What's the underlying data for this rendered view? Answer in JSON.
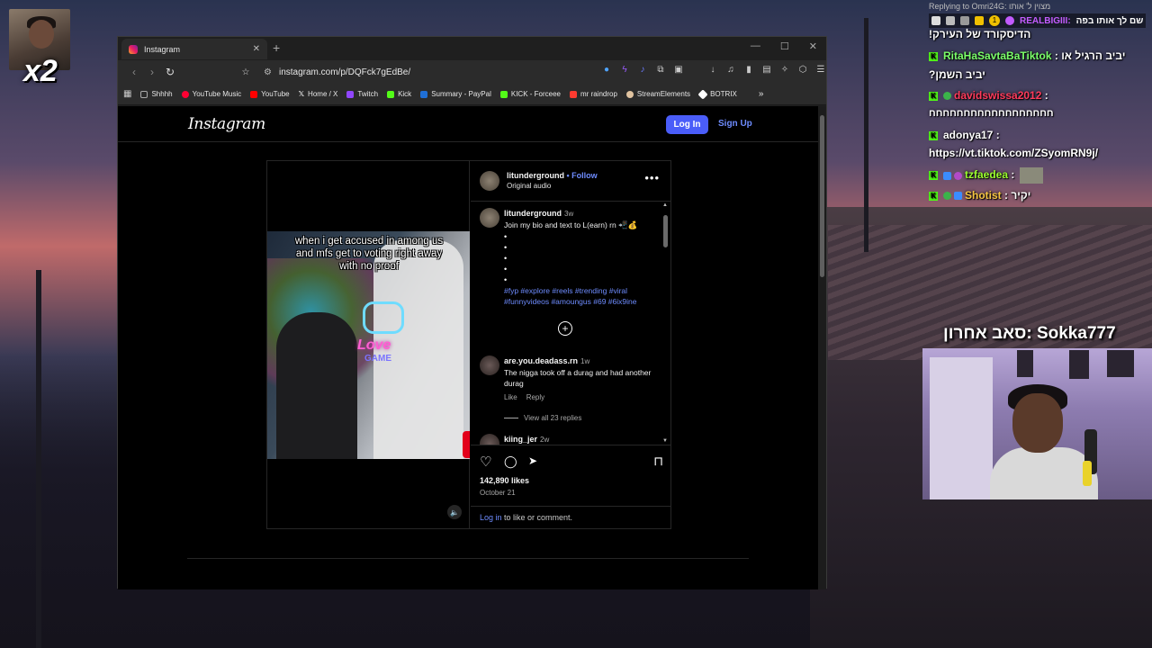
{
  "browser": {
    "tab_title": "Instagram",
    "new_tab": "+",
    "window_controls": [
      "—",
      "☐",
      "✕"
    ],
    "tab_close": "✕",
    "url": "instagram.com/p/DQFck7gEdBe/",
    "bookmarks": [
      {
        "label": "Shhhh",
        "color": "#9e9e9e"
      },
      {
        "label": "YouTube Music",
        "color": "#ff0033"
      },
      {
        "label": "YouTube",
        "color": "#ff0000"
      },
      {
        "label": "Home / X",
        "color": "#ffffff"
      },
      {
        "label": "Twitch",
        "color": "#9146ff"
      },
      {
        "label": "Kick",
        "color": "#53fc18"
      },
      {
        "label": "Summary - PayPal",
        "color": "#1f6fd6"
      },
      {
        "label": "KICK - Forceee",
        "color": "#53fc18"
      },
      {
        "label": "mr raindrop",
        "color": "#ff3b30"
      },
      {
        "label": "StreamElements",
        "color": "#e0c3a0"
      },
      {
        "label": "BOTRIX",
        "color": "#ffffff"
      }
    ],
    "bookmarks_more": "»"
  },
  "instagram": {
    "logo": "Instagram",
    "login_label": "Log In",
    "signup_label": "Sign Up",
    "post": {
      "username": "litunderground",
      "follow": "• Follow",
      "audio": "Original audio",
      "more": "•••",
      "meme_text": "when i get accused in among us and mfs get to voting right away with no proof",
      "overlay_love": "Love",
      "overlay_game": "GAME",
      "caption_user": "litunderground",
      "caption_time": "3w",
      "caption_text": "Join my bio and text to L(earn) rn 📲💰",
      "caption_dots": "•\n•\n•\n•\n•",
      "hashtags": "#fyp #explore #reels #trending #viral #funnyvideos #amoungus #69 #6ix9ine",
      "load_more": "+",
      "comment1_user": "are.you.deadass.rn",
      "comment1_time": "1w",
      "comment1_text": "The nigga took off a durag and had another durag",
      "like_label": "Like",
      "reply_label": "Reply",
      "view_replies": "View all 23 replies",
      "comment2_user": "kiing_jer",
      "comment2_time": "2w",
      "likes": "142,890 likes",
      "date": "October 21",
      "login_link": "Log in",
      "login_suffix": " to like or comment."
    }
  },
  "stream": {
    "multiplier": "x2",
    "reply_header": "Replying to Omri24G: מצוין ל' אותו",
    "top_user": "REALBIGIII:",
    "top_msg": "שם לך אותו בפה",
    "top_badge_count": "1",
    "chat": [
      {
        "user": "",
        "msg": "!הדיסקורד של העירק",
        "color": "#ffffff"
      },
      {
        "user": "RitaHaSavtaBaTiktok",
        "msg": ": יביב הרגיל או",
        "color": "#7bff6a"
      },
      {
        "user": "",
        "msg": "?יביב השמן",
        "color": "#ffffff"
      },
      {
        "user": "davidswissa2012",
        "msg": ":",
        "color": "#ff3b5c"
      },
      {
        "user": "",
        "msg": "חחחחחחחחחחחחחחחחחח",
        "color": "#ffffff"
      },
      {
        "user": "adonya17",
        "msg": ":",
        "color": "#ffffff"
      },
      {
        "user": "",
        "msg": "https://vt.tiktok.com/ZSyomRN9j/",
        "color": "#ffffff"
      },
      {
        "user": "tzfaedea",
        "msg": ":",
        "color": "#9bff2e"
      },
      {
        "user": "Shotist",
        "msg": ": יקיר",
        "color": "#f5c542"
      }
    ],
    "last_sub": "סאב אחרון: Sokka777"
  },
  "icons": {
    "back": "‹",
    "forward": "›",
    "reload": "↻",
    "bookmark": "🔖",
    "heart": "♡",
    "comment": "◯",
    "share": "➤",
    "save": "⊓",
    "mute": "🔈"
  }
}
